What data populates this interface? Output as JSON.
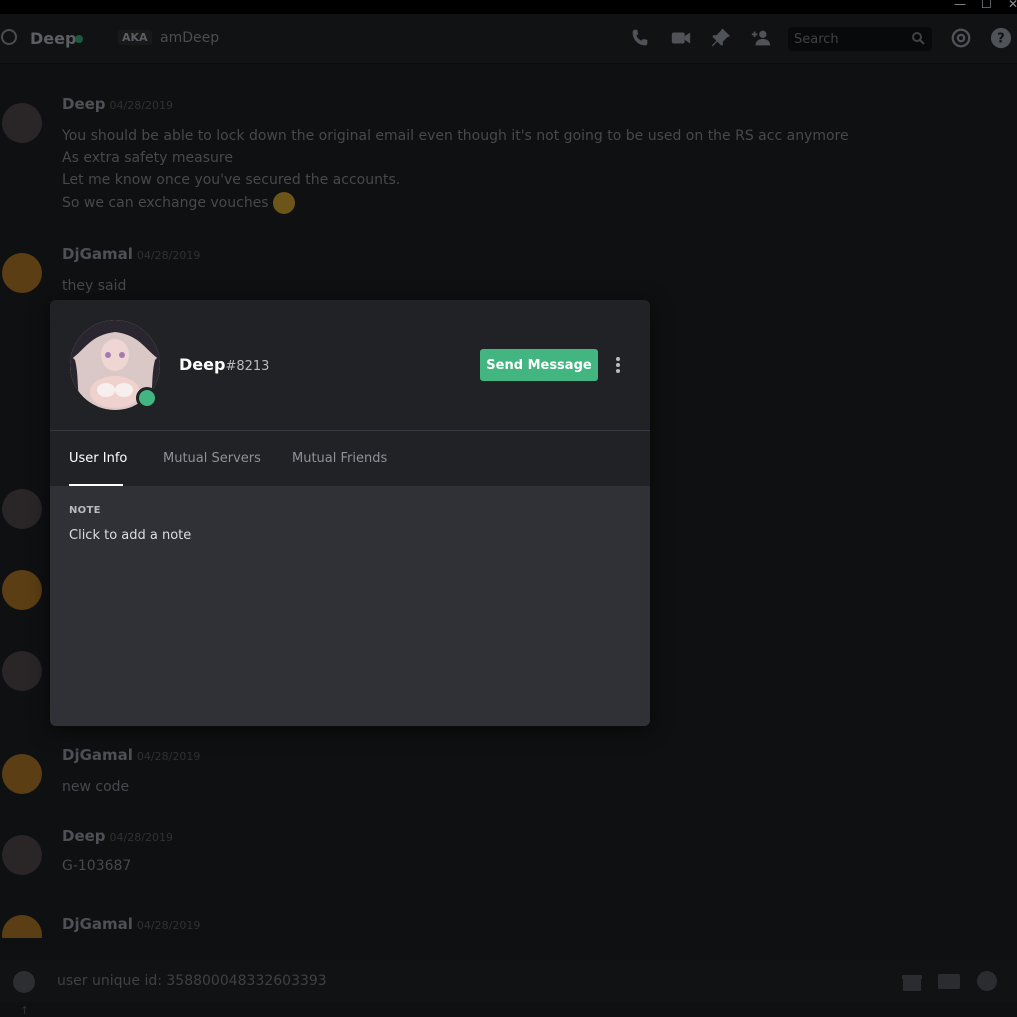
{
  "header": {
    "channel_name": "Deep",
    "aka_label": "AKA",
    "alias": "amDeep",
    "search_placeholder": "Search"
  },
  "messages": [
    {
      "author": "Deep",
      "timestamp": "04/28/2019",
      "lines": [
        "You should be able to lock down the original email even though it's not going to be used on the RS acc anymore",
        "As extra safety measure",
        "Let me know once you've secured the accounts.",
        "So we can exchange vouches"
      ]
    },
    {
      "author": "DjGamal",
      "timestamp": "04/28/2019",
      "lines": [
        "they said"
      ]
    },
    {
      "author": "DjGamal",
      "timestamp": "04/28/2019",
      "lines": [
        "new code"
      ]
    },
    {
      "author": "Deep",
      "timestamp": "04/28/2019",
      "lines": [
        "G-103687"
      ]
    },
    {
      "author": "DjGamal",
      "timestamp": "04/28/2019",
      "lines": []
    }
  ],
  "popout": {
    "username": "Deep",
    "discriminator": "#8213",
    "send_button": "Send Message",
    "tabs": [
      "User Info",
      "Mutual Servers",
      "Mutual Friends"
    ],
    "active_tab": "User Info",
    "note_heading": "NOTE",
    "note_placeholder": "Click to add a note",
    "status_color": "#43b581"
  },
  "composer": {
    "text": "user unique id: 358800048332603393"
  },
  "colors": {
    "accent_green": "#43b581",
    "popout_header": "#202225",
    "popout_body": "#2f3136"
  }
}
